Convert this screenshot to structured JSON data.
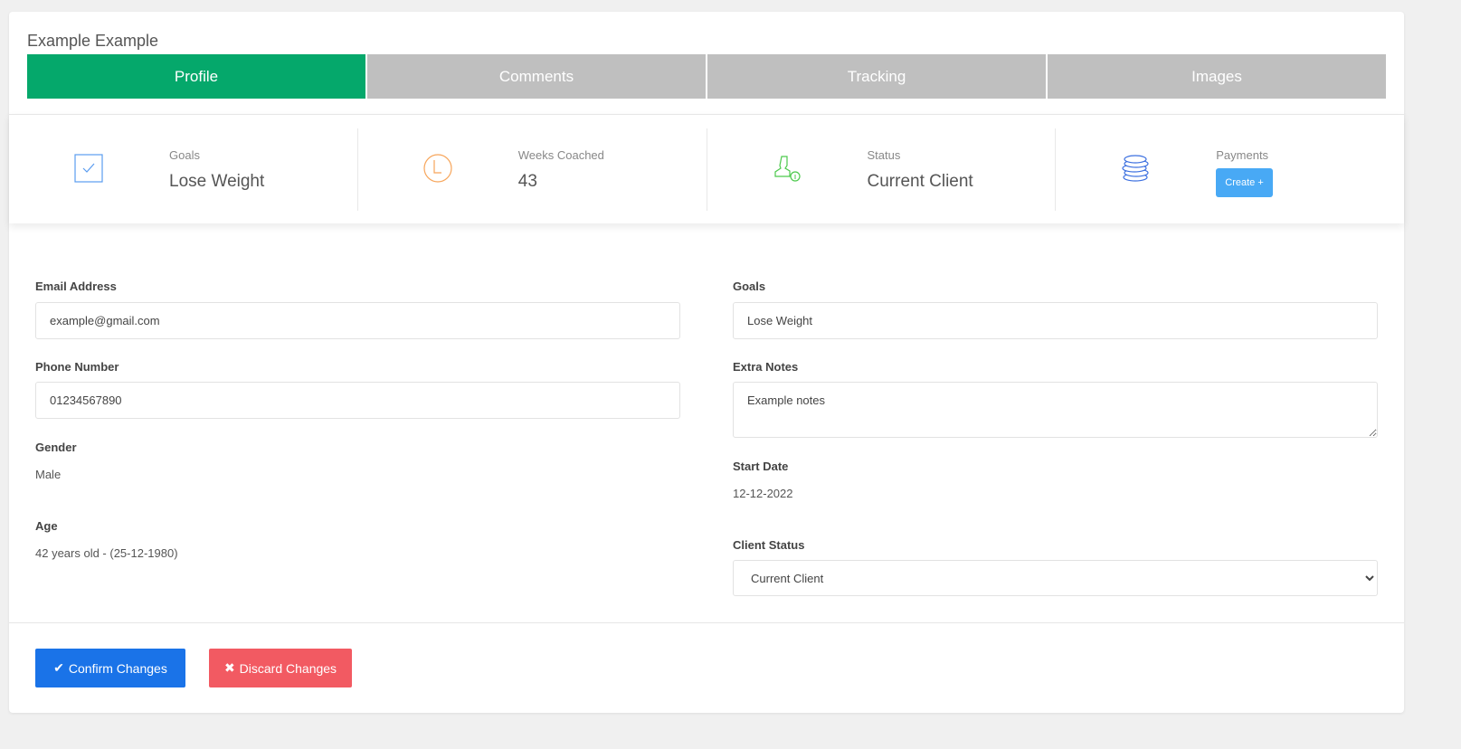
{
  "title": "Example Example",
  "tabs": [
    {
      "label": "Profile",
      "active": true
    },
    {
      "label": "Comments"
    },
    {
      "label": "Tracking"
    },
    {
      "label": "Images"
    }
  ],
  "stats": {
    "goals": {
      "label": "Goals",
      "value": "Lose Weight",
      "icon": "checkbox-icon"
    },
    "weeks": {
      "label": "Weeks Coached",
      "value": "43",
      "icon": "clock-icon"
    },
    "status": {
      "label": "Status",
      "value": "Current Client",
      "icon": "user-info-icon"
    },
    "payments": {
      "label": "Payments",
      "button": "Create +",
      "icon": "coins-icon"
    }
  },
  "form": {
    "email": {
      "label": "Email Address",
      "value": "example@gmail.com"
    },
    "phone": {
      "label": "Phone Number",
      "value": "01234567890"
    },
    "gender": {
      "label": "Gender",
      "value": "Male"
    },
    "age": {
      "label": "Age",
      "value": "42 years old - (25-12-1980)"
    },
    "goals": {
      "label": "Goals",
      "value": "Lose Weight"
    },
    "notes": {
      "label": "Extra Notes",
      "value": "Example notes"
    },
    "start": {
      "label": "Start Date",
      "value": "12-12-2022"
    },
    "client_status": {
      "label": "Client Status",
      "value": "Current Client"
    }
  },
  "actions": {
    "confirm": "Confirm Changes",
    "discard": "Discard Changes"
  },
  "colors": {
    "active_tab": "#05a86b",
    "inactive_tab": "#bfbfbf",
    "confirm": "#1a73e8",
    "discard": "#f25a62",
    "create": "#48a9f5"
  }
}
